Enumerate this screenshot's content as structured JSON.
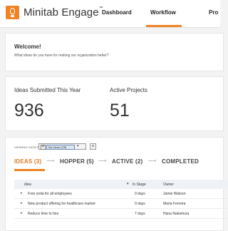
{
  "header": {
    "brand": "Minitab Engage",
    "brand_mark": "™",
    "nav": [
      "Dashboard",
      "Workflow",
      "Pro"
    ]
  },
  "welcome": {
    "title": "Welcome!",
    "subtitle": "What ideas do you have for making our organization better?"
  },
  "stats": [
    {
      "label": "Ideas Submitted This Year",
      "value": "936"
    },
    {
      "label": "Active Projects",
      "value": "51"
    }
  ],
  "filter": {
    "label": "VIEWING DATA FOR:",
    "clear": "✕",
    "chip": "My Ideas (Off)",
    "caret": "▾",
    "add": "+"
  },
  "stages": [
    {
      "label": "IDEAS (3)",
      "active": true
    },
    {
      "label": "HOPPER (5)",
      "active": false
    },
    {
      "label": "ACTIVE (2)",
      "active": false
    },
    {
      "label": "COMPLETED",
      "active": false
    }
  ],
  "stage_arrow": "⟶",
  "table": {
    "headers": [
      "Idea",
      "In Stage",
      "Owner"
    ],
    "sort_caret": "▾",
    "rows": [
      {
        "idea": "Free soda for all employees",
        "in_stage": "0 days",
        "owner": "Jamie Watson"
      },
      {
        "idea": "New product offering for healthcare market",
        "in_stage": "0 days",
        "owner": "Maria Ferreira"
      },
      {
        "idea": "Reduce time to hire",
        "in_stage": "7 days",
        "owner": "Hana Nakamura"
      }
    ],
    "expand_glyph": "▸"
  },
  "colors": {
    "accent": "#f08323",
    "background": "#f3f3f3"
  }
}
